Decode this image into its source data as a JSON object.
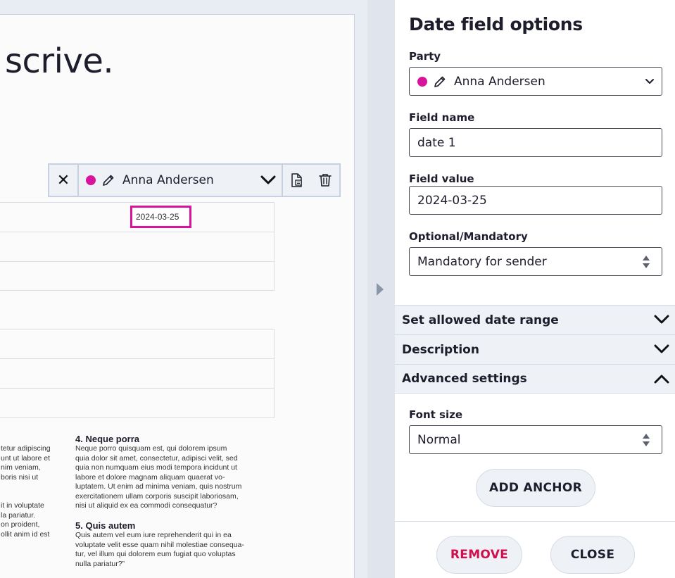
{
  "document": {
    "logo_text": "scrive.",
    "date_field_value": "2024-03-25",
    "toolbar": {
      "close_glyph": "✕",
      "party_name": "Anna Andersen"
    },
    "lorem_left_lines": "tetur adipiscing\nunt ut labore et\nnim veniam,\nboris nisi ut\n\n\nit in voluptate\nla pariatur.\non proident,\nollit anim id est",
    "section4_title": "4. Neque porra",
    "section4_text": "Neque porro quisquam est, qui dolorem ipsum\nquia dolor sit amet, consectetur, adipisci velit, sed\nquia non numquam eius modi tempora incidunt ut\nlabore et dolore magnam aliquam quaerat vo-\nluptatem. Ut enim ad minima veniam, quis nostrum\nexercitationem ullam corporis suscipit laboriosam,\nnisi ut aliquid ex ea commodi consequatur?",
    "section5_title": "5. Quis autem",
    "section5_text": "Quis autem vel eum iure reprehenderit qui in ea\nvoluptate velit esse quam nihil molestiae consequa-\ntur, vel illum qui dolorem eum fugiat quo voluptas\nnulla pariatur?”"
  },
  "panel": {
    "title": "Date field options",
    "party_label": "Party",
    "party_value": "Anna Andersen",
    "party_color": "#d7149b",
    "field_name_label": "Field name",
    "field_name_value": "date 1",
    "field_value_label": "Field value",
    "field_value_value": "2024-03-25",
    "optional_label": "Optional/Mandatory",
    "optional_value": "Mandatory for sender",
    "sections": {
      "date_range": "Set allowed date range",
      "description": "Description",
      "advanced": "Advanced settings"
    },
    "font_size_label": "Font size",
    "font_size_value": "Normal",
    "add_anchor_label": "ADD ANCHOR",
    "remove_label": "REMOVE",
    "close_label": "CLOSE",
    "remove_color": "#d0104c"
  }
}
